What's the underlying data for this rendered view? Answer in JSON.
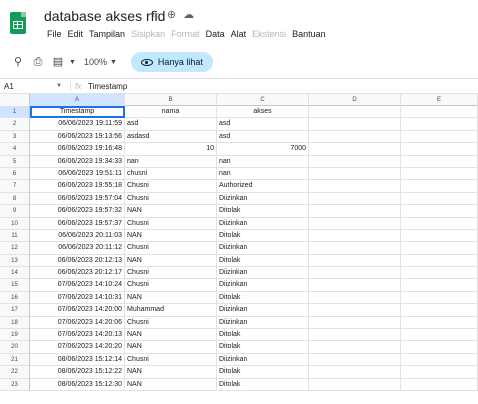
{
  "app": {
    "doc_title": "database akses rfid",
    "title_icons": [
      "star-icon",
      "move-to-folder-icon",
      "cloud-status-icon"
    ]
  },
  "menu": [
    {
      "label": "File",
      "enabled": true
    },
    {
      "label": "Edit",
      "enabled": true
    },
    {
      "label": "Tampilan",
      "enabled": true
    },
    {
      "label": "Sisipkan",
      "enabled": false
    },
    {
      "label": "Format",
      "enabled": false
    },
    {
      "label": "Data",
      "enabled": true
    },
    {
      "label": "Alat",
      "enabled": true
    },
    {
      "label": "Ekstensi",
      "enabled": false
    },
    {
      "label": "Bantuan",
      "enabled": true
    }
  ],
  "toolbar": {
    "zoom": "100%",
    "view_only_label": "Hanya lihat"
  },
  "formula_bar": {
    "name_box": "A1",
    "fx_symbol": "fx",
    "value": "Timestamp"
  },
  "grid": {
    "columns": [
      "A",
      "B",
      "C",
      "D",
      "E"
    ],
    "rows": [
      {
        "n": "1",
        "a": "Timestamp",
        "b": "nama",
        "c": "akses"
      },
      {
        "n": "2",
        "a": "06/06/2023 19:11:59",
        "b": "asd",
        "c": "asd"
      },
      {
        "n": "3",
        "a": "06/06/2023 19:13:56",
        "b": "asdasd",
        "c": "asd"
      },
      {
        "n": "4",
        "a": "06/06/2023 19:16:48",
        "b": "10",
        "c": "7000"
      },
      {
        "n": "5",
        "a": "06/06/2023 19:34:33",
        "b": "nan",
        "c": "nan"
      },
      {
        "n": "6",
        "a": "06/06/2023 19:51:11",
        "b": "chusni",
        "c": "nan"
      },
      {
        "n": "7",
        "a": "06/06/2023 19:55:18",
        "b": "Chusni",
        "c": "Authorized"
      },
      {
        "n": "8",
        "a": "06/06/2023 19:57:04",
        "b": "Chusni",
        "c": "Diizinkan"
      },
      {
        "n": "9",
        "a": "06/06/2023 19:57:32",
        "b": "NAN",
        "c": "Ditolak"
      },
      {
        "n": "10",
        "a": "06/06/2023 19:57:37",
        "b": "Chusni",
        "c": "Diizinkan"
      },
      {
        "n": "11",
        "a": "06/06/2023 20:11:03",
        "b": "NAN",
        "c": "Ditolak"
      },
      {
        "n": "12",
        "a": "06/06/2023 20:11:12",
        "b": "Chusni",
        "c": "Diizinkan"
      },
      {
        "n": "13",
        "a": "06/06/2023 20:12:13",
        "b": "NAN",
        "c": "Ditolak"
      },
      {
        "n": "14",
        "a": "06/06/2023 20:12:17",
        "b": "Chusni",
        "c": "Diizinkan"
      },
      {
        "n": "15",
        "a": "07/06/2023 14:10:24",
        "b": "Chusni",
        "c": "Diizinkan"
      },
      {
        "n": "16",
        "a": "07/06/2023 14:10:31",
        "b": "NAN",
        "c": "Ditolak"
      },
      {
        "n": "17",
        "a": "07/06/2023 14:20:00",
        "b": "Muhammad",
        "c": "Diizinkan"
      },
      {
        "n": "18",
        "a": "07/06/2023 14:20:06",
        "b": "Chusni",
        "c": "Diizinkan"
      },
      {
        "n": "19",
        "a": "07/06/2023 14:20:13",
        "b": "NAN",
        "c": "Ditolak"
      },
      {
        "n": "20",
        "a": "07/06/2023 14:20:20",
        "b": "NAN",
        "c": "Ditolak"
      },
      {
        "n": "21",
        "a": "08/06/2023 15:12:14",
        "b": "Chusni",
        "c": "Diizinkan"
      },
      {
        "n": "22",
        "a": "08/06/2023 15:12:22",
        "b": "NAN",
        "c": "Ditolak"
      },
      {
        "n": "23",
        "a": "08/06/2023 15:12:30",
        "b": "NAN",
        "c": "Ditolak"
      }
    ]
  }
}
